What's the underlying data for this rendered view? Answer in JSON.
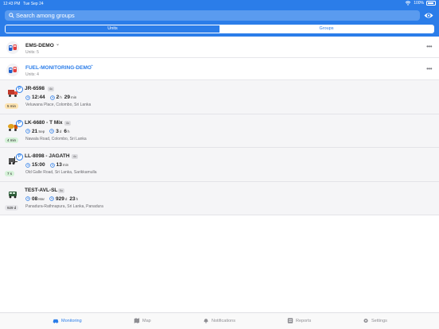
{
  "status_bar": {
    "time": "12:43 PM",
    "date": "Tue Sep 24",
    "battery": "100%"
  },
  "search": {
    "placeholder": "Search among groups"
  },
  "segments": {
    "units": "Units",
    "groups": "Groups"
  },
  "groups": [
    {
      "name": "EMS-DEMO",
      "units": "Units: 5",
      "expanded": false
    },
    {
      "name": "FUEL-MONITORING-DEMO",
      "units": "Units: 4",
      "expanded": true
    }
  ],
  "units": [
    {
      "name": "JR-6598",
      "badge": "4u",
      "age": "5 min",
      "age_color": "#fde3b0",
      "d1": "12:44",
      "d2a": "2",
      "d2a_unit": "h",
      "d2b": "29",
      "d2b_unit": "min",
      "address": "Veluwana Place, Colombo, Sri Lanka",
      "icon": "truck-red-icon",
      "parked": true
    },
    {
      "name": "LK-6680 - T Mix",
      "badge": "4u",
      "age": "4 min",
      "age_color": "#d6f2d9",
      "d1": "21",
      "d1_unit": "Sep",
      "d2a": "3",
      "d2a_unit": "d",
      "d2b": "6",
      "d2b_unit": "h",
      "address": "Nawala Road, Colombo, Sri Lanka",
      "icon": "truck-mixer-icon",
      "parked": true
    },
    {
      "name": "LL-8098 - JAGATH",
      "badge": "4u",
      "age": "7 s",
      "age_color": "#d6f2d9",
      "d1": "15:00",
      "d2a": "13",
      "d2a_unit": "min",
      "d2b": "",
      "d2b_unit": "",
      "address": "Old Galle Road, Sri Lanka, Sarikkamulla",
      "icon": "forklift-icon",
      "parked": true
    },
    {
      "name": "TEST-AVL-SL",
      "badge": "5u",
      "age": "929 d",
      "age_color": "#e6e6ea",
      "d1": "08",
      "d1_unit": "Mar",
      "d2a": "929",
      "d2a_unit": "d",
      "d2b": "23",
      "d2b_unit": "h",
      "address": "Panadura-Rathnapura, Sri Lanka, Panadura",
      "icon": "bus-icon",
      "parked": false
    }
  ],
  "tabs": [
    {
      "label": "Monitoring",
      "icon": "car-icon"
    },
    {
      "label": "Map",
      "icon": "map-icon"
    },
    {
      "label": "Notifications",
      "icon": "bell-icon"
    },
    {
      "label": "Reports",
      "icon": "reports-icon"
    },
    {
      "label": "Settings",
      "icon": "gear-icon"
    }
  ],
  "colors": {
    "accent": "#2b7de9"
  }
}
